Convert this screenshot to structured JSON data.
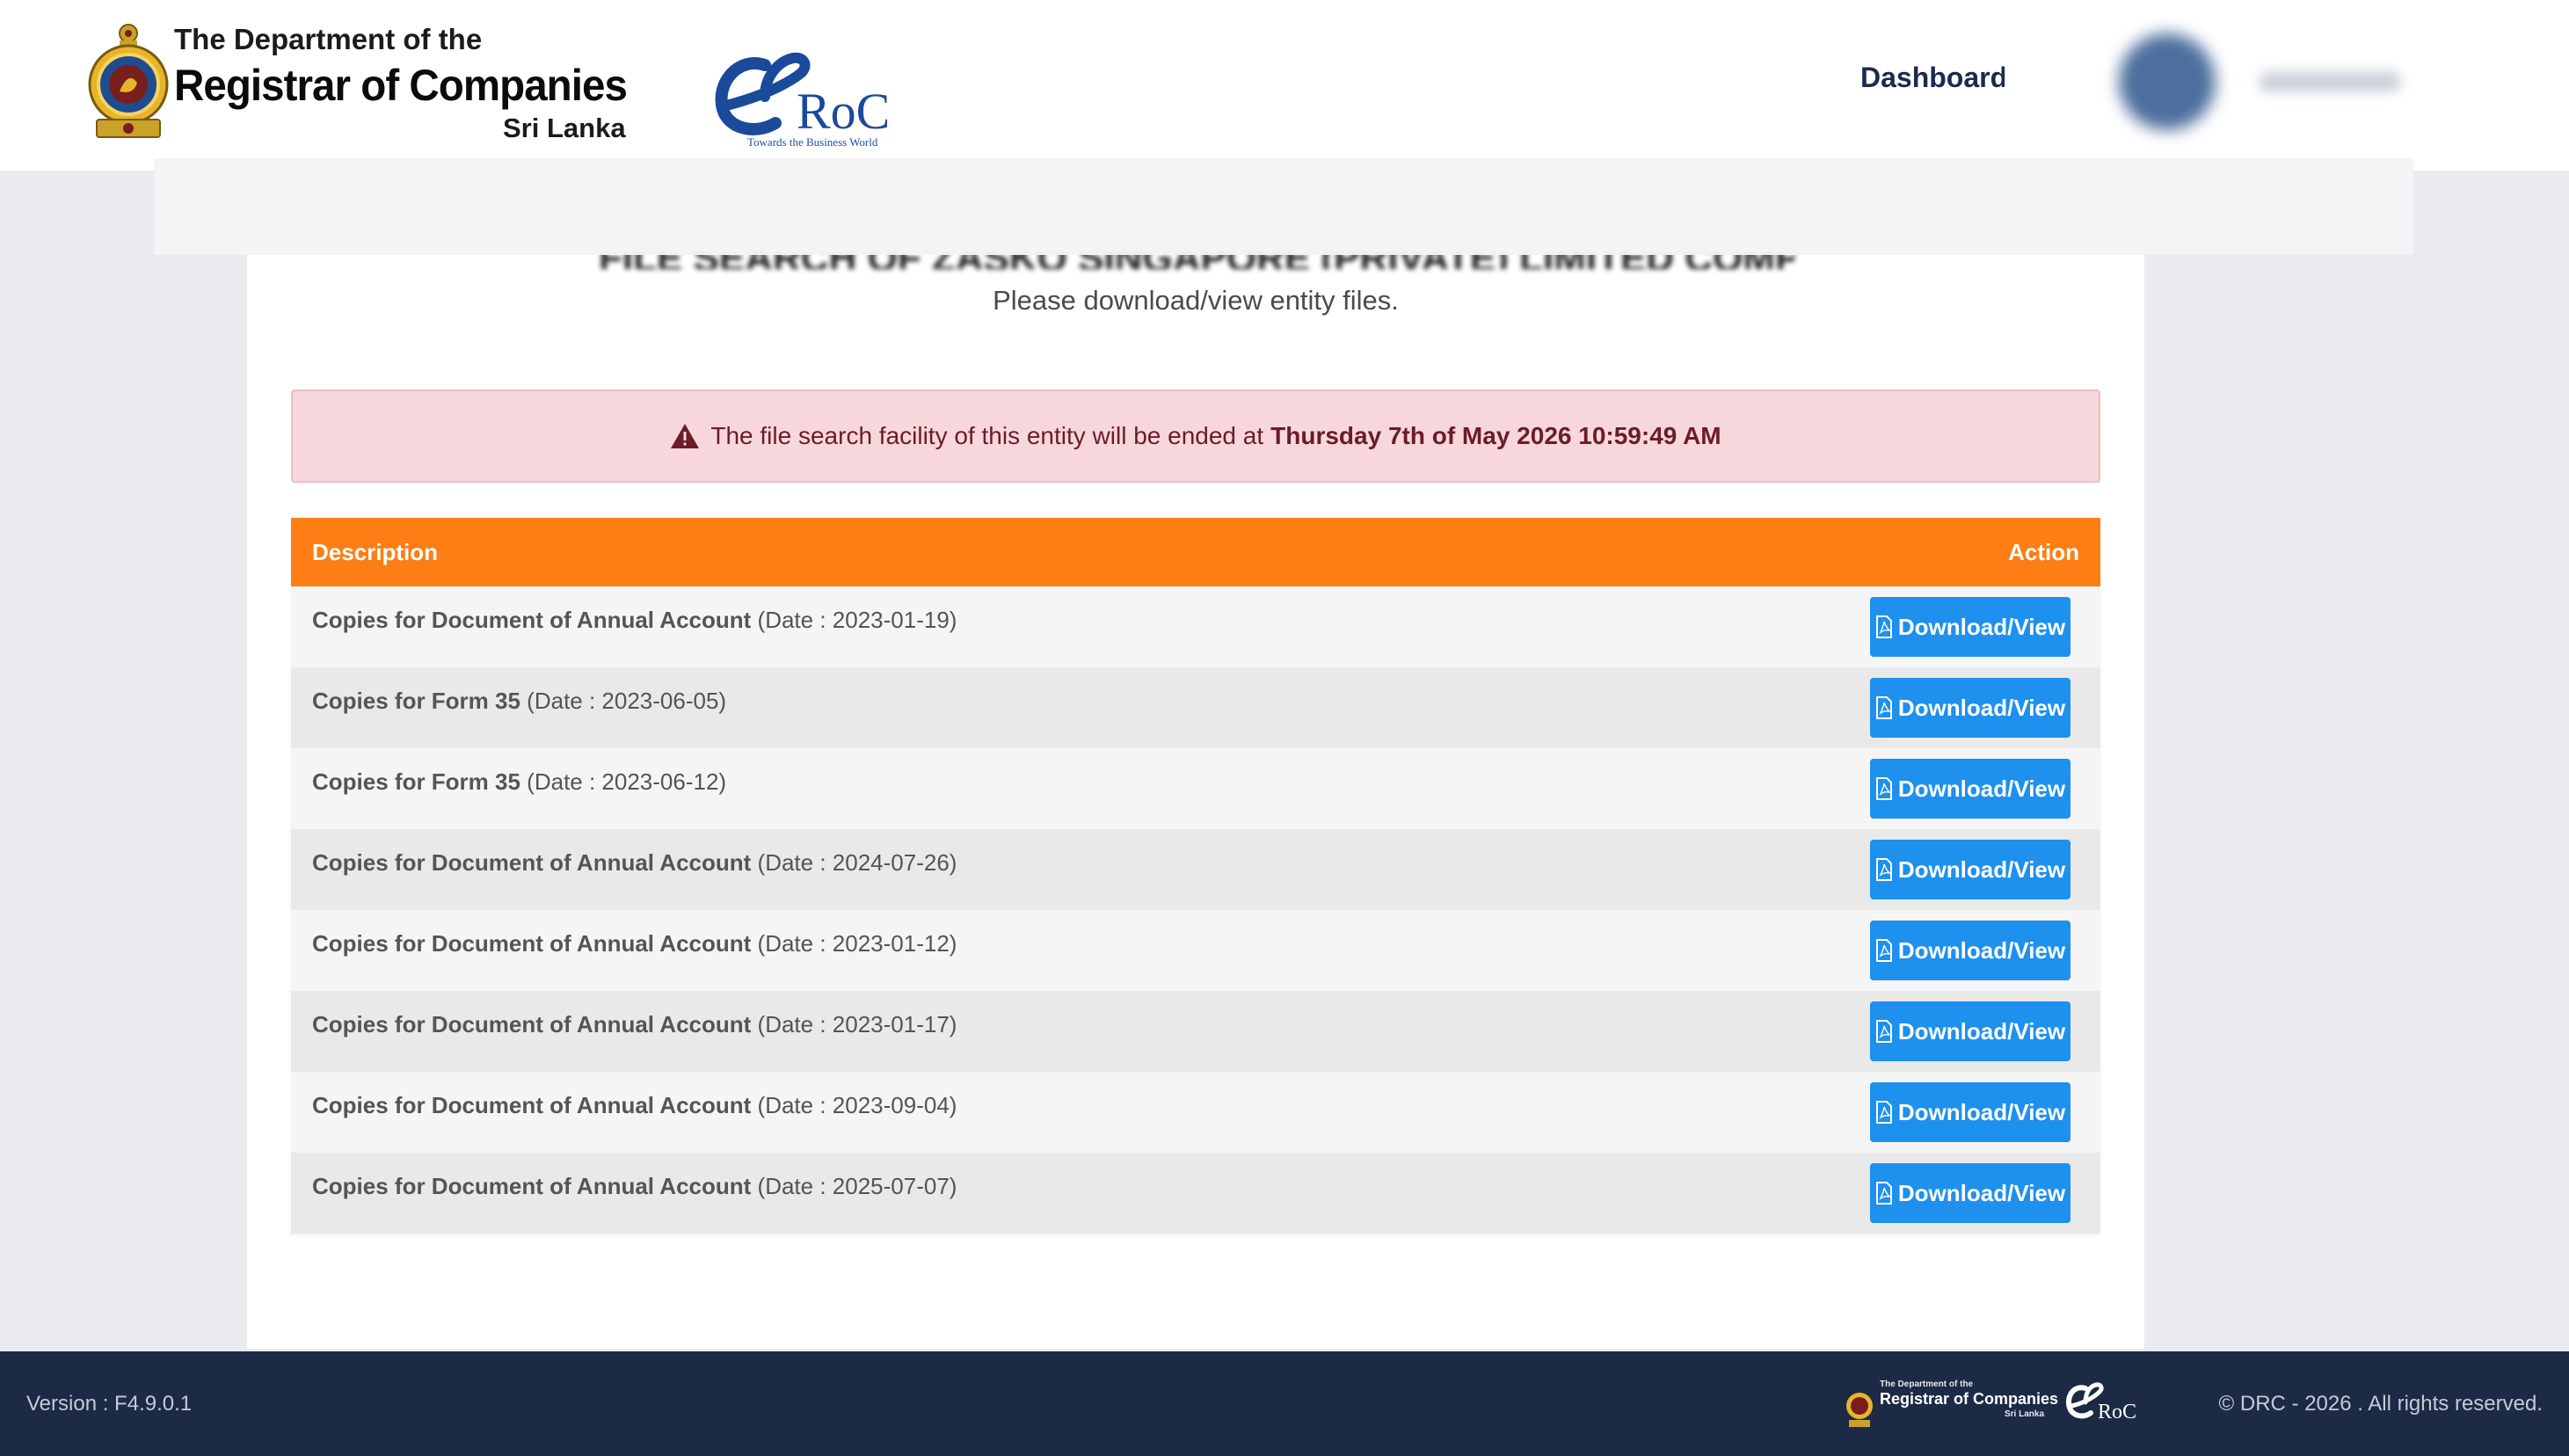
{
  "header": {
    "org_line1": "The Department of the",
    "org_line2": "Registrar of Companies",
    "org_line3": "Sri Lanka",
    "eroc_logo": "RoC",
    "eroc_tagline": "Towards the Business World",
    "nav_dashboard": "Dashboard"
  },
  "page": {
    "title": "FILE SEARCH OF ZASKO SINGAPORE (PRIVATE) LIMITED COMPANY",
    "subtitle": "Please download/view entity files."
  },
  "alert": {
    "icon": "warning-triangle-icon",
    "text": "The file search facility of this entity will be ended at",
    "date": "Thursday 7th of May 2026 10:59:49 AM"
  },
  "table": {
    "header_description": "Description",
    "header_action": "Action",
    "button_label": "Download/View",
    "button_icon": "pdf-file-icon",
    "rows": [
      {
        "title": "Copies for Document of Annual Account",
        "date": "(Date : 2023-01-19)"
      },
      {
        "title": "Copies for Form 35",
        "date": "(Date : 2023-06-05)"
      },
      {
        "title": "Copies for Form 35",
        "date": "(Date : 2023-06-12)"
      },
      {
        "title": "Copies for Document of Annual Account",
        "date": "(Date : 2024-07-26)"
      },
      {
        "title": "Copies for Document of Annual Account",
        "date": "(Date : 2023-01-12)"
      },
      {
        "title": "Copies for Document of Annual Account",
        "date": "(Date : 2023-01-17)"
      },
      {
        "title": "Copies for Document of Annual Account",
        "date": "(Date : 2023-09-04)"
      },
      {
        "title": "Copies for Document of Annual Account",
        "date": "(Date : 2025-07-07)"
      }
    ]
  },
  "footer": {
    "version": "Version : F4.9.0.1",
    "copyright": "© DRC - 2026 . All rights reserved.",
    "logo_line1": "The Department of the",
    "logo_line2": "Registrar of Companies",
    "logo_line3": "Sri Lanka"
  },
  "colors": {
    "table_header": "#fd7e14",
    "button": "#1e90ee",
    "alert_bg": "#f7d7dc",
    "footer_bg": "#1d2a46"
  }
}
